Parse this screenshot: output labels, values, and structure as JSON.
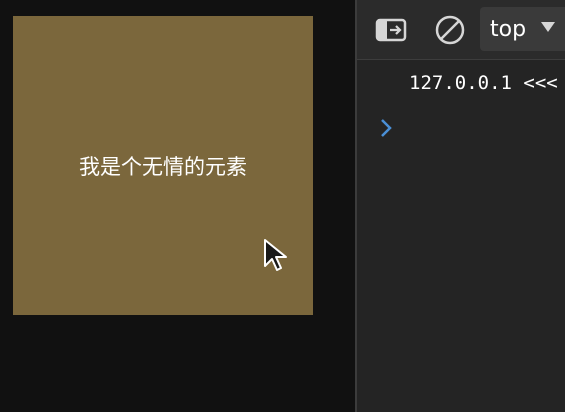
{
  "page": {
    "box_text": "我是个无情的元素",
    "box_color": "#7b673c"
  },
  "devtools": {
    "toolbar": {
      "context_selected": "top"
    },
    "console": {
      "lines": [
        "127.0.0.1 <<<"
      ]
    },
    "icons": {
      "sidebar_toggle": "sidebar-toggle-icon",
      "clear": "clear-console-icon",
      "caret": "caret-down-icon",
      "prompt": "chevron-right-icon"
    },
    "colors": {
      "prompt": "#4a8fd6",
      "toolbar_bg": "#2b2b2b",
      "panel_bg": "#242424"
    }
  }
}
